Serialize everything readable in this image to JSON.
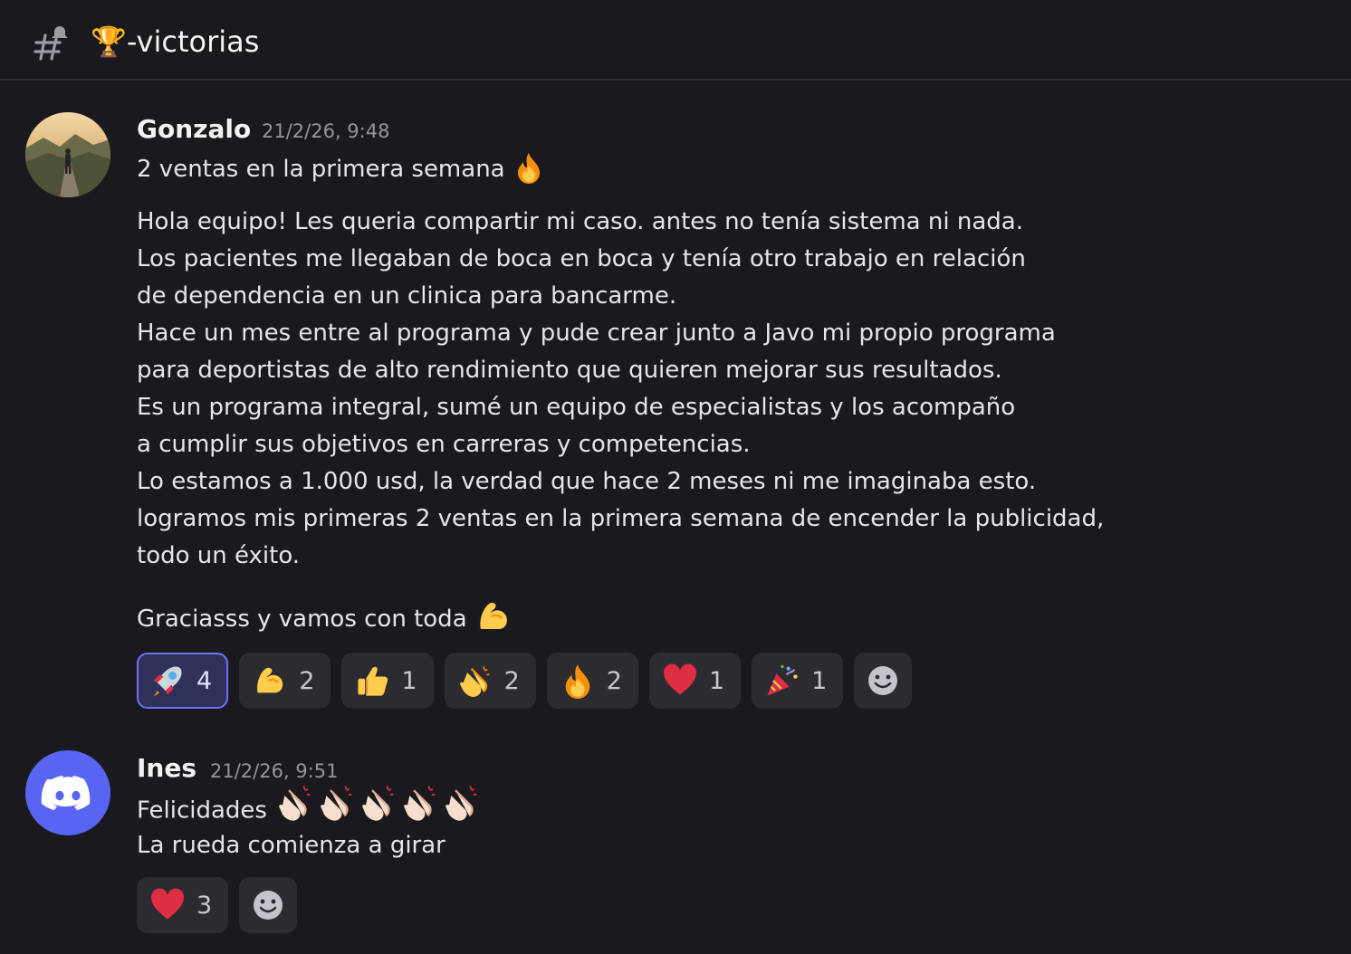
{
  "channel": {
    "title": "🏆-victorias",
    "icon": "threads-hash-icon"
  },
  "messages": [
    {
      "author": "Gonzalo",
      "timestamp": "21/2/26, 9:48",
      "avatar": "photo-runner-on-road",
      "lines": [
        "2 ventas en la primera semana",
        "Hola equipo! Les queria compartir mi caso. antes no tenía sistema ni nada.",
        "Los pacientes me llegaban de boca en boca y tenía otro trabajo en relación",
        "de dependencia en un clinica para bancarme.",
        "Hace un mes entre al programa y pude crear junto a Javo mi propio programa",
        "para deportistas de alto rendimiento que quieren mejorar sus resultados.",
        "Es un programa integral, sumé un equipo de especialistas y los acompaño",
        "a cumplir sus objetivos en carreras y competencias.",
        "Lo estamos a 1.000 usd, la verdad que hace 2 meses ni me imaginaba esto.",
        "logramos mis primeras 2 ventas en la primera semana de encender la publicidad,",
        "todo un éxito.",
        "Graciasss y vamos con toda"
      ],
      "reactions": [
        {
          "emoji": "rocket",
          "count": "4",
          "active": true
        },
        {
          "emoji": "flexed-biceps",
          "count": "2"
        },
        {
          "emoji": "thumbs-up",
          "count": "1"
        },
        {
          "emoji": "clapping-hands",
          "count": "2"
        },
        {
          "emoji": "fire",
          "count": "2"
        },
        {
          "emoji": "red-heart",
          "count": "1"
        },
        {
          "emoji": "party-popper",
          "count": "1"
        }
      ]
    },
    {
      "author": "Ines",
      "timestamp": "21/2/26, 9:51",
      "avatar": "discord-logo",
      "lines": [
        "Felicidades",
        "La rueda comienza a girar"
      ],
      "reactions": [
        {
          "emoji": "red-heart",
          "count": "3"
        }
      ]
    }
  ],
  "colors": {
    "background": "#1a1a1e",
    "active_reaction_border": "#6b72ff",
    "discord_blurple": "#5865f2"
  }
}
